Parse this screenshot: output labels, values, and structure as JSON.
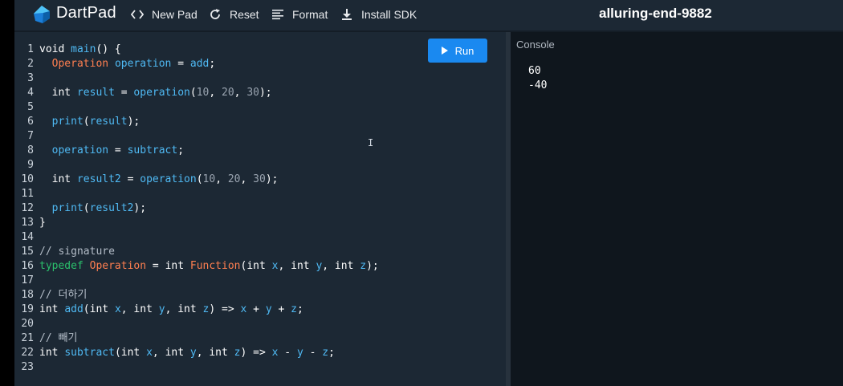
{
  "header": {
    "brand": "DartPad",
    "new_pad": "New Pad",
    "reset": "Reset",
    "format": "Format",
    "install_sdk": "Install SDK",
    "pad_name": "alluring-end-9882"
  },
  "run_label": "Run",
  "console": {
    "title": "Console",
    "output": [
      "60",
      "-40"
    ]
  },
  "code_lines": [
    [
      [
        "kw",
        "void "
      ],
      [
        "fn",
        "main"
      ],
      [
        "pl",
        "() {"
      ]
    ],
    [
      [
        "pl",
        "  "
      ],
      [
        "ty",
        "Operation"
      ],
      [
        "pl",
        " "
      ],
      [
        "var",
        "operation"
      ],
      [
        "pl",
        " = "
      ],
      [
        "var",
        "add"
      ],
      [
        "pl",
        ";"
      ]
    ],
    [],
    [
      [
        "pl",
        "  "
      ],
      [
        "kw",
        "int"
      ],
      [
        "pl",
        " "
      ],
      [
        "var",
        "result"
      ],
      [
        "pl",
        " = "
      ],
      [
        "var",
        "operation"
      ],
      [
        "pl",
        "("
      ],
      [
        "num",
        "10"
      ],
      [
        "pl",
        ", "
      ],
      [
        "num",
        "20"
      ],
      [
        "pl",
        ", "
      ],
      [
        "num",
        "30"
      ],
      [
        "pl",
        ");"
      ]
    ],
    [],
    [
      [
        "pl",
        "  "
      ],
      [
        "fn",
        "print"
      ],
      [
        "pl",
        "("
      ],
      [
        "var",
        "result"
      ],
      [
        "pl",
        ");"
      ]
    ],
    [],
    [
      [
        "pl",
        "  "
      ],
      [
        "var",
        "operation"
      ],
      [
        "pl",
        " = "
      ],
      [
        "var",
        "subtract"
      ],
      [
        "pl",
        ";"
      ]
    ],
    [],
    [
      [
        "pl",
        "  "
      ],
      [
        "kw",
        "int"
      ],
      [
        "pl",
        " "
      ],
      [
        "var",
        "result2"
      ],
      [
        "pl",
        " = "
      ],
      [
        "var",
        "operation"
      ],
      [
        "pl",
        "("
      ],
      [
        "num",
        "10"
      ],
      [
        "pl",
        ", "
      ],
      [
        "num",
        "20"
      ],
      [
        "pl",
        ", "
      ],
      [
        "num",
        "30"
      ],
      [
        "pl",
        ");"
      ]
    ],
    [],
    [
      [
        "pl",
        "  "
      ],
      [
        "fn",
        "print"
      ],
      [
        "pl",
        "("
      ],
      [
        "var",
        "result2"
      ],
      [
        "pl",
        ");"
      ]
    ],
    [
      [
        "pl",
        "}"
      ]
    ],
    [],
    [
      [
        "cm",
        "// signature"
      ]
    ],
    [
      [
        "tdef",
        "typedef "
      ],
      [
        "ty",
        "Operation"
      ],
      [
        "pl",
        " = "
      ],
      [
        "kw",
        "int"
      ],
      [
        "pl",
        " "
      ],
      [
        "ty",
        "Function"
      ],
      [
        "pl",
        "("
      ],
      [
        "kw",
        "int"
      ],
      [
        "pl",
        " "
      ],
      [
        "var",
        "x"
      ],
      [
        "pl",
        ", "
      ],
      [
        "kw",
        "int"
      ],
      [
        "pl",
        " "
      ],
      [
        "var",
        "y"
      ],
      [
        "pl",
        ", "
      ],
      [
        "kw",
        "int"
      ],
      [
        "pl",
        " "
      ],
      [
        "var",
        "z"
      ],
      [
        "pl",
        ");"
      ]
    ],
    [],
    [
      [
        "cm",
        "// 더하기"
      ]
    ],
    [
      [
        "kw",
        "int"
      ],
      [
        "pl",
        " "
      ],
      [
        "fn",
        "add"
      ],
      [
        "pl",
        "("
      ],
      [
        "kw",
        "int"
      ],
      [
        "pl",
        " "
      ],
      [
        "var",
        "x"
      ],
      [
        "pl",
        ", "
      ],
      [
        "kw",
        "int"
      ],
      [
        "pl",
        " "
      ],
      [
        "var",
        "y"
      ],
      [
        "pl",
        ", "
      ],
      [
        "kw",
        "int"
      ],
      [
        "pl",
        " "
      ],
      [
        "var",
        "z"
      ],
      [
        "pl",
        ") => "
      ],
      [
        "var",
        "x"
      ],
      [
        "pl",
        " + "
      ],
      [
        "var",
        "y"
      ],
      [
        "pl",
        " + "
      ],
      [
        "var",
        "z"
      ],
      [
        "pl",
        ";"
      ]
    ],
    [],
    [
      [
        "cm",
        "// 빼기"
      ]
    ],
    [
      [
        "kw",
        "int"
      ],
      [
        "pl",
        " "
      ],
      [
        "fn",
        "subtract"
      ],
      [
        "pl",
        "("
      ],
      [
        "kw",
        "int"
      ],
      [
        "pl",
        " "
      ],
      [
        "var",
        "x"
      ],
      [
        "pl",
        ", "
      ],
      [
        "kw",
        "int"
      ],
      [
        "pl",
        " "
      ],
      [
        "var",
        "y"
      ],
      [
        "pl",
        ", "
      ],
      [
        "kw",
        "int"
      ],
      [
        "pl",
        " "
      ],
      [
        "var",
        "z"
      ],
      [
        "pl",
        ") => "
      ],
      [
        "var",
        "x"
      ],
      [
        "pl",
        " - "
      ],
      [
        "var",
        "y"
      ],
      [
        "pl",
        " - "
      ],
      [
        "var",
        "z"
      ],
      [
        "pl",
        ";"
      ]
    ],
    []
  ],
  "colors": {
    "accent": "#1a89f0",
    "background": "#1c2834",
    "console_background": "#0f161d"
  },
  "cursor_glyph": "I"
}
